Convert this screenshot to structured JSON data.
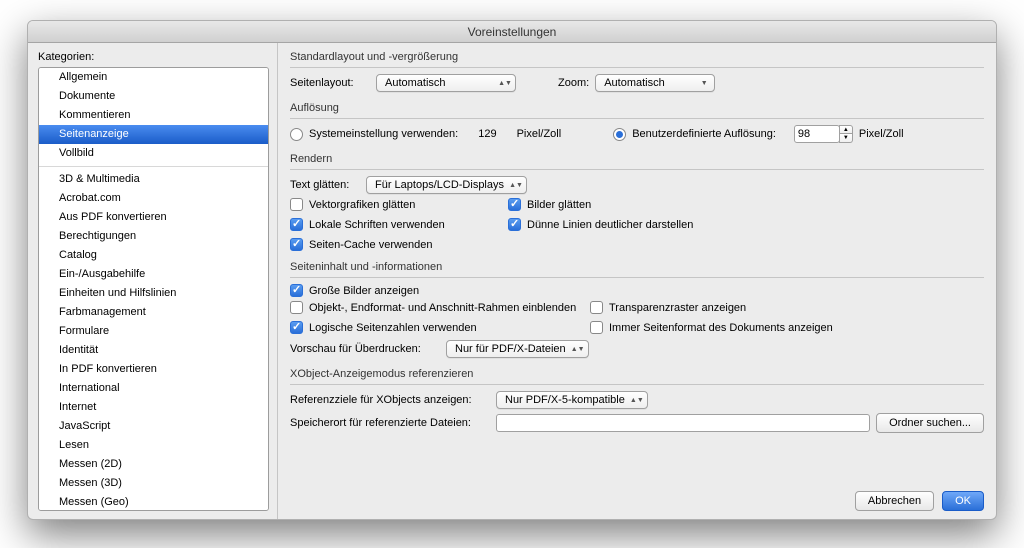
{
  "window": {
    "title": "Voreinstellungen"
  },
  "sidebar": {
    "label": "Kategorien:",
    "group1": [
      "Allgemein",
      "Dokumente",
      "Kommentieren",
      "Seitenanzeige",
      "Vollbild"
    ],
    "group2": [
      "3D & Multimedia",
      "Acrobat.com",
      "Aus PDF konvertieren",
      "Berechtigungen",
      "Catalog",
      "Ein-/Ausgabehilfe",
      "Einheiten und Hilfslinien",
      "Farbmanagement",
      "Formulare",
      "Identität",
      "In PDF konvertieren",
      "International",
      "Internet",
      "JavaScript",
      "Lesen",
      "Messen (2D)",
      "Messen (3D)",
      "Messen (Geo)"
    ],
    "selected": "Seitenanzeige"
  },
  "sections": {
    "layout": {
      "title": "Standardlayout und -vergrößerung",
      "page_layout_label": "Seitenlayout:",
      "page_layout_value": "Automatisch",
      "zoom_label": "Zoom:",
      "zoom_value": "Automatisch"
    },
    "resolution": {
      "title": "Auflösung",
      "use_system_label": "Systemeinstellung verwenden:",
      "system_value": "129",
      "unit": "Pixel/Zoll",
      "custom_label": "Benutzerdefinierte Auflösung:",
      "custom_value": "98"
    },
    "render": {
      "title": "Rendern",
      "smooth_text_label": "Text glätten:",
      "smooth_text_value": "Für Laptops/LCD-Displays",
      "chk_vector": "Vektorgrafiken glätten",
      "chk_images": "Bilder glätten",
      "chk_localfonts": "Lokale Schriften verwenden",
      "chk_thinlines": "Dünne Linien deutlicher darstellen",
      "chk_pagecache": "Seiten-Cache verwenden"
    },
    "content": {
      "title": "Seiteninhalt und -informationen",
      "chk_large_images": "Große Bilder anzeigen",
      "chk_boxes": "Objekt-, Endformat- und Anschnitt-Rahmen einblenden",
      "chk_transparency": "Transparenzraster anzeigen",
      "chk_logical": "Logische Seitenzahlen verwenden",
      "chk_always_format": "Immer Seitenformat des Dokuments anzeigen",
      "overprint_label": "Vorschau für Überdrucken:",
      "overprint_value": "Nur für PDF/X-Dateien"
    },
    "xobject": {
      "title": "XObject-Anzeigemodus referenzieren",
      "ref_label": "Referenzziele für XObjects anzeigen:",
      "ref_value": "Nur PDF/X-5-kompatible",
      "path_label": "Speicherort für referenzierte Dateien:",
      "browse_btn": "Ordner suchen..."
    }
  },
  "buttons": {
    "cancel": "Abbrechen",
    "ok": "OK"
  }
}
